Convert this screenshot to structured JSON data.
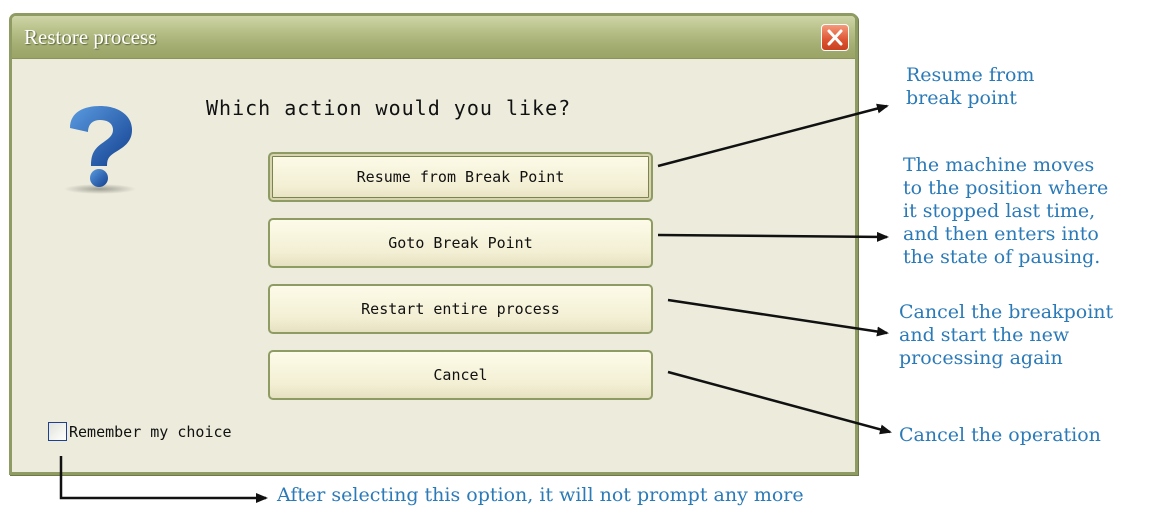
{
  "window": {
    "title": "Restore process"
  },
  "dialog": {
    "prompt": "Which action would you like?",
    "buttons": {
      "resume": "Resume from Break Point",
      "goto": "Goto Break Point",
      "restart": "Restart entire process",
      "cancel": "Cancel"
    },
    "remember_label": "Remember my choice",
    "remember_checked": false
  },
  "annotations": {
    "resume": [
      "Resume from",
      "break point"
    ],
    "goto": [
      "The machine moves",
      "to the position where",
      "it stopped last time,",
      "and then enters into",
      "the state of pausing."
    ],
    "restart": [
      "Cancel the breakpoint",
      "and start the new",
      "processing again"
    ],
    "cancel": "Cancel the operation",
    "remember": "After selecting this option, it will not prompt any more"
  },
  "icons": {
    "dialog_icon": "question-icon",
    "close": "close-icon"
  },
  "colors": {
    "title_bar": "#a4ad72",
    "dialog_bg": "#ecebdc",
    "close_button": "#dd5433",
    "annotation_text": "#2b7ab8",
    "question_mark": "#1f63b6"
  }
}
